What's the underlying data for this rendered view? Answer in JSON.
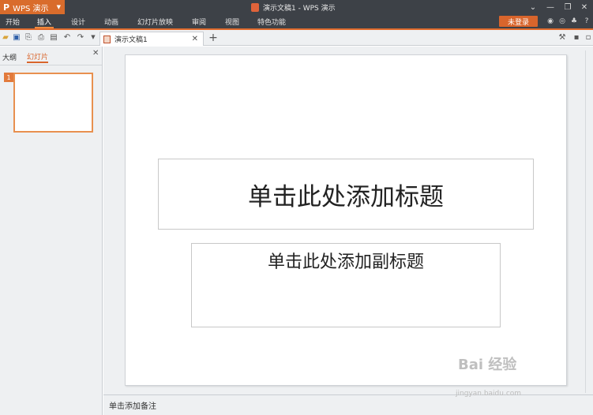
{
  "titlebar": {
    "app_logo": "P",
    "app_name": "WPS 演示",
    "window_title": "演示文稿1 - WPS 演示"
  },
  "menu": {
    "items": [
      "开始",
      "插入",
      "设计",
      "动画",
      "幻灯片放映",
      "审阅",
      "视图",
      "特色功能"
    ],
    "active": "插入",
    "login_label": "未登录"
  },
  "doc_tab": {
    "label": "演示文稿1"
  },
  "left_panel": {
    "tabs": [
      "大纲",
      "幻灯片"
    ],
    "active_tab": "幻灯片",
    "slides": [
      {
        "number": "1"
      }
    ]
  },
  "slide": {
    "title_placeholder": "单击此处添加标题",
    "subtitle_placeholder": "单击此处添加副标题"
  },
  "notes": {
    "placeholder": "单击添加备注"
  },
  "watermark": {
    "text": "Bai 经验",
    "url": "jingyan.baidu.com"
  },
  "colors": {
    "accent": "#d9652c",
    "chrome_dark": "#3d4147",
    "panel_bg": "#eef0f2"
  }
}
